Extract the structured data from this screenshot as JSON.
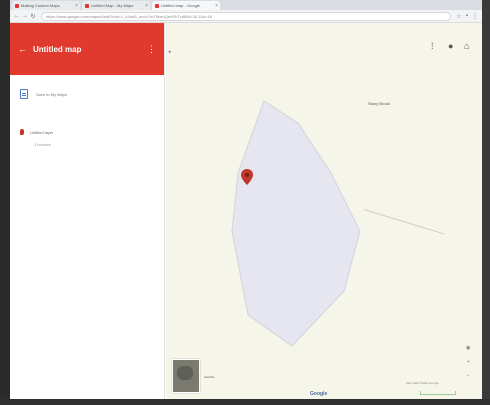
{
  "browser": {
    "tabs": [
      {
        "label": "Making Custom Maps"
      },
      {
        "label": "Untitled Map - My Maps"
      },
      {
        "label": "Untitled map - Google"
      }
    ],
    "url": "https://www.google.com/maps/d/edit?mid=1_K4xkE_anUr7mTMxmQeAFhTvdfl&ll=34.1&z=16"
  },
  "panel": {
    "title": "Untitled map",
    "save_label": "Save to My Maps",
    "layer_label": "Untitled layer",
    "sub_label": "1 location",
    "accent": "#e03a2e"
  },
  "map": {
    "place_label": "Stony Brook",
    "satellite_label": "Satellite",
    "google_logo": "Google",
    "copyright": "Map data ©2016 Google",
    "polygon_color": "#e6e6f0",
    "pin_color": "#c2372c"
  }
}
